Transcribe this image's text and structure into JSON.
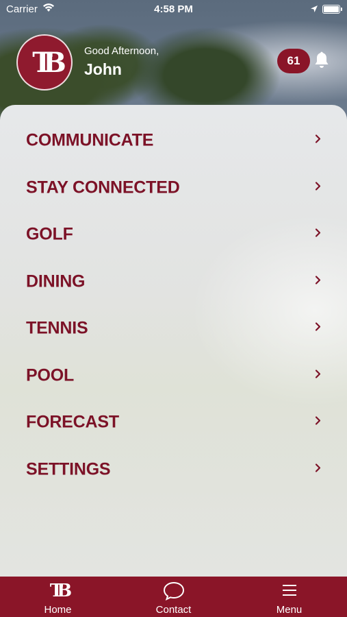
{
  "status_bar": {
    "carrier": "Carrier",
    "time": "4:58 PM",
    "icons": [
      "wifi-icon",
      "location-arrow-icon",
      "battery-icon"
    ]
  },
  "header": {
    "logo_text": "TB",
    "greeting": "Good Afternoon,",
    "user_name": "John",
    "notification_count": "61",
    "bell_icon": "bell-icon"
  },
  "menu": {
    "items": [
      {
        "label": "COMMUNICATE"
      },
      {
        "label": "STAY CONNECTED"
      },
      {
        "label": "GOLF"
      },
      {
        "label": "DINING"
      },
      {
        "label": "TENNIS"
      },
      {
        "label": "POOL"
      },
      {
        "label": "FORECAST"
      },
      {
        "label": "SETTINGS"
      }
    ],
    "chevron_icon": "chevron-right-icon"
  },
  "tab_bar": {
    "tabs": [
      {
        "label": "Home",
        "icon": "tb-logo-icon"
      },
      {
        "label": "Contact",
        "icon": "chat-bubble-icon"
      },
      {
        "label": "Menu",
        "icon": "hamburger-menu-icon"
      }
    ]
  },
  "colors": {
    "brand": "#8a1528",
    "menu_text": "#7c1227",
    "panel": "#e3e4e1"
  }
}
